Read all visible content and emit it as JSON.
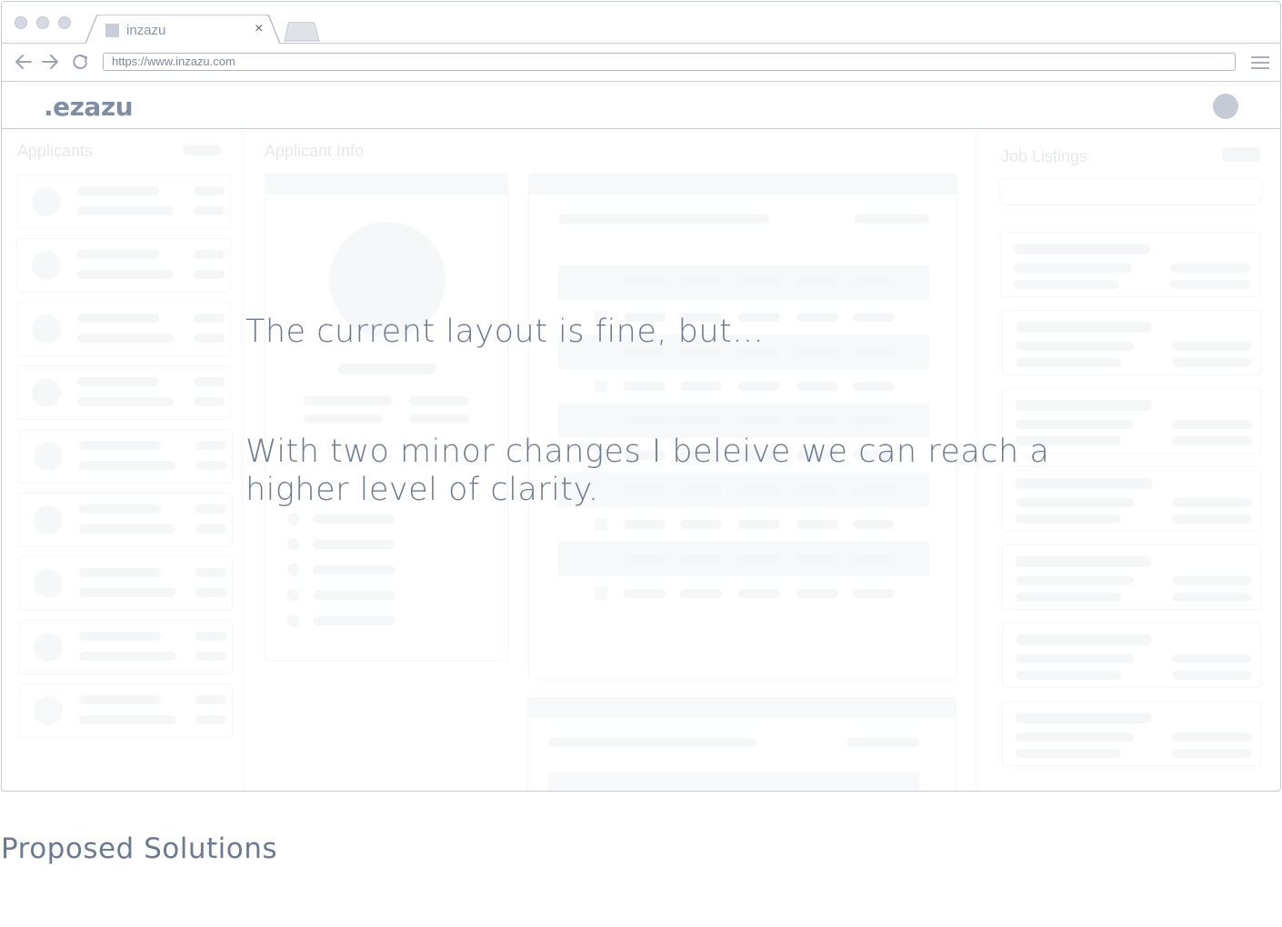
{
  "browser": {
    "tab_title": "inzazu",
    "url": "https://www.inzazu.com",
    "close_glyph": "×"
  },
  "app": {
    "logo_text": ".ezazu"
  },
  "panels": {
    "applicants_title": "Applicants",
    "applicant_info_title": "Applicant Info",
    "job_listings_title": "Job Listings"
  },
  "overlay": {
    "line1": "The current layout is fine, but...",
    "line2a": "With two minor changes I beleive we can reach a",
    "line2b": "higher level of clarity."
  },
  "footer": {
    "title": "Proposed Solutions"
  },
  "colors": {
    "frame": "#c4cbd6",
    "text_accent": "#6b7a92",
    "placeholder": "#c9ced6"
  },
  "icons": [
    "back-arrow-icon",
    "forward-arrow-icon",
    "reload-icon",
    "hamburger-menu-icon",
    "favicon-icon",
    "close-icon",
    "avatar-icon"
  ]
}
